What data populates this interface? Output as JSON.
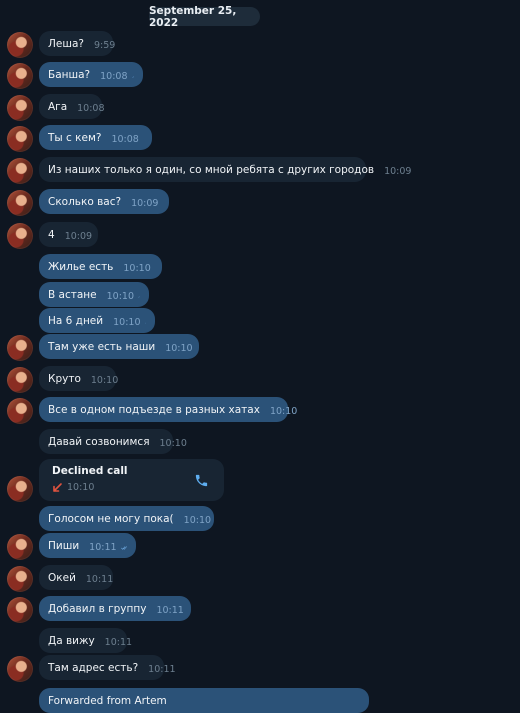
{
  "date": "September 25, 2022",
  "messages": [
    {
      "text": "Леша?",
      "time": "9:59",
      "dir": "in"
    },
    {
      "text": "Банша?",
      "time": "10:08",
      "dir": "out"
    },
    {
      "text": "Ага",
      "time": "10:08",
      "dir": "in"
    },
    {
      "text": "Ты с кем?",
      "time": "10:08",
      "dir": "out"
    },
    {
      "text": "Из наших только я один, со мной ребята с других городов",
      "time": "10:09",
      "dir": "in"
    },
    {
      "text": "Сколько вас?",
      "time": "10:09",
      "dir": "out"
    },
    {
      "text": "4",
      "time": "10:09",
      "dir": "in"
    },
    {
      "text": "Жилье есть",
      "time": "10:10",
      "dir": "out"
    },
    {
      "text": "В астане",
      "time": "10:10",
      "dir": "out"
    },
    {
      "text": "На 6 дней",
      "time": "10:10",
      "dir": "out"
    },
    {
      "text": "Там уже есть наши",
      "time": "10:10",
      "dir": "out"
    },
    {
      "text": "Круто",
      "time": "10:10",
      "dir": "in"
    },
    {
      "text": "Все в одном подъезде в разных хатах",
      "time": "10:10",
      "dir": "out"
    },
    {
      "text": "Давай созвонимся",
      "time": "10:10",
      "dir": "in"
    },
    {
      "text": "Голосом не могу пока(",
      "time": "10:10",
      "dir": "out"
    },
    {
      "text": "Пиши",
      "time": "10:11",
      "dir": "out"
    },
    {
      "text": "Окей",
      "time": "10:11",
      "dir": "in"
    },
    {
      "text": "Добавил в группу",
      "time": "10:11",
      "dir": "out"
    },
    {
      "text": "Да вижу",
      "time": "10:11",
      "dir": "in"
    },
    {
      "text": "Там адрес есть?",
      "time": "10:11",
      "dir": "in"
    }
  ],
  "call": {
    "title": "Declined call",
    "time": "10:10",
    "icon": "phone-icon",
    "status_icon": "missed-call-arrow-icon"
  },
  "partial_bottom": {
    "text": "Forwarded from Artem"
  },
  "colors": {
    "background": "#0e1621",
    "incoming": "#182533",
    "outgoing": "#2b5278",
    "accent": "#5eaef0",
    "declined": "#e0533f"
  }
}
